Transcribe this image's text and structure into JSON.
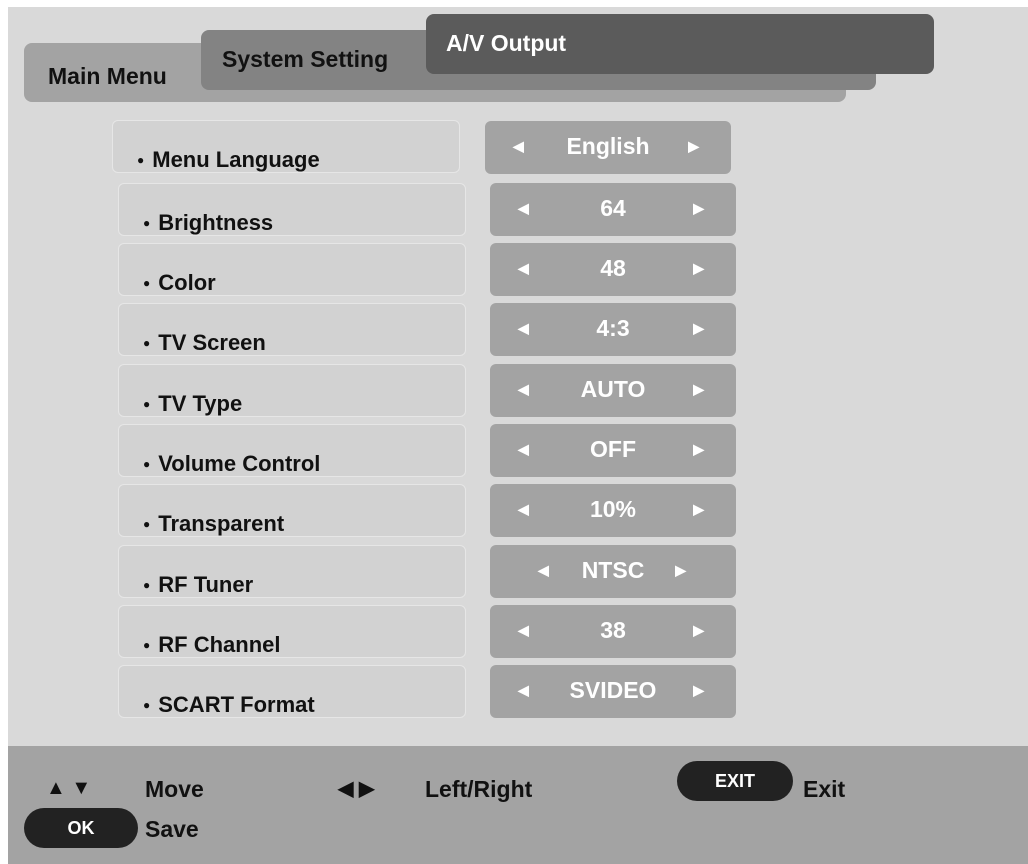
{
  "tabs": {
    "main_menu": "Main Menu",
    "system_setting": "System Setting",
    "av_output": "A/V Output"
  },
  "settings": [
    {
      "label": "Menu Language",
      "value": "English"
    },
    {
      "label": "Brightness",
      "value": "64"
    },
    {
      "label": "Color",
      "value": "48"
    },
    {
      "label": "TV Screen",
      "value": "4:3"
    },
    {
      "label": "TV Type",
      "value": "AUTO"
    },
    {
      "label": "Volume Control",
      "value": "OFF"
    },
    {
      "label": "Transparent",
      "value": "10%"
    },
    {
      "label": "RF Tuner",
      "value": "NTSC"
    },
    {
      "label": "RF Channel",
      "value": "38"
    },
    {
      "label": "SCART Format",
      "value": "SVIDEO"
    }
  ],
  "value_arrows": {
    "left": "◀",
    "right": "▶"
  },
  "footer": {
    "move_glyphs": "▲ ▼",
    "move_label": "Move",
    "leftright_glyphs": "◀ ▶",
    "leftright_label": "Left/Right",
    "exit_button": "EXIT",
    "exit_label": "Exit",
    "ok_button": "OK",
    "save_label": "Save"
  },
  "colors": {
    "background": "#d9d9d9",
    "tab_main": "#a3a3a3",
    "tab_system": "#838383",
    "tab_active": "#5b5b5b",
    "value_box": "#a3a3a3",
    "pill": "#222222"
  }
}
